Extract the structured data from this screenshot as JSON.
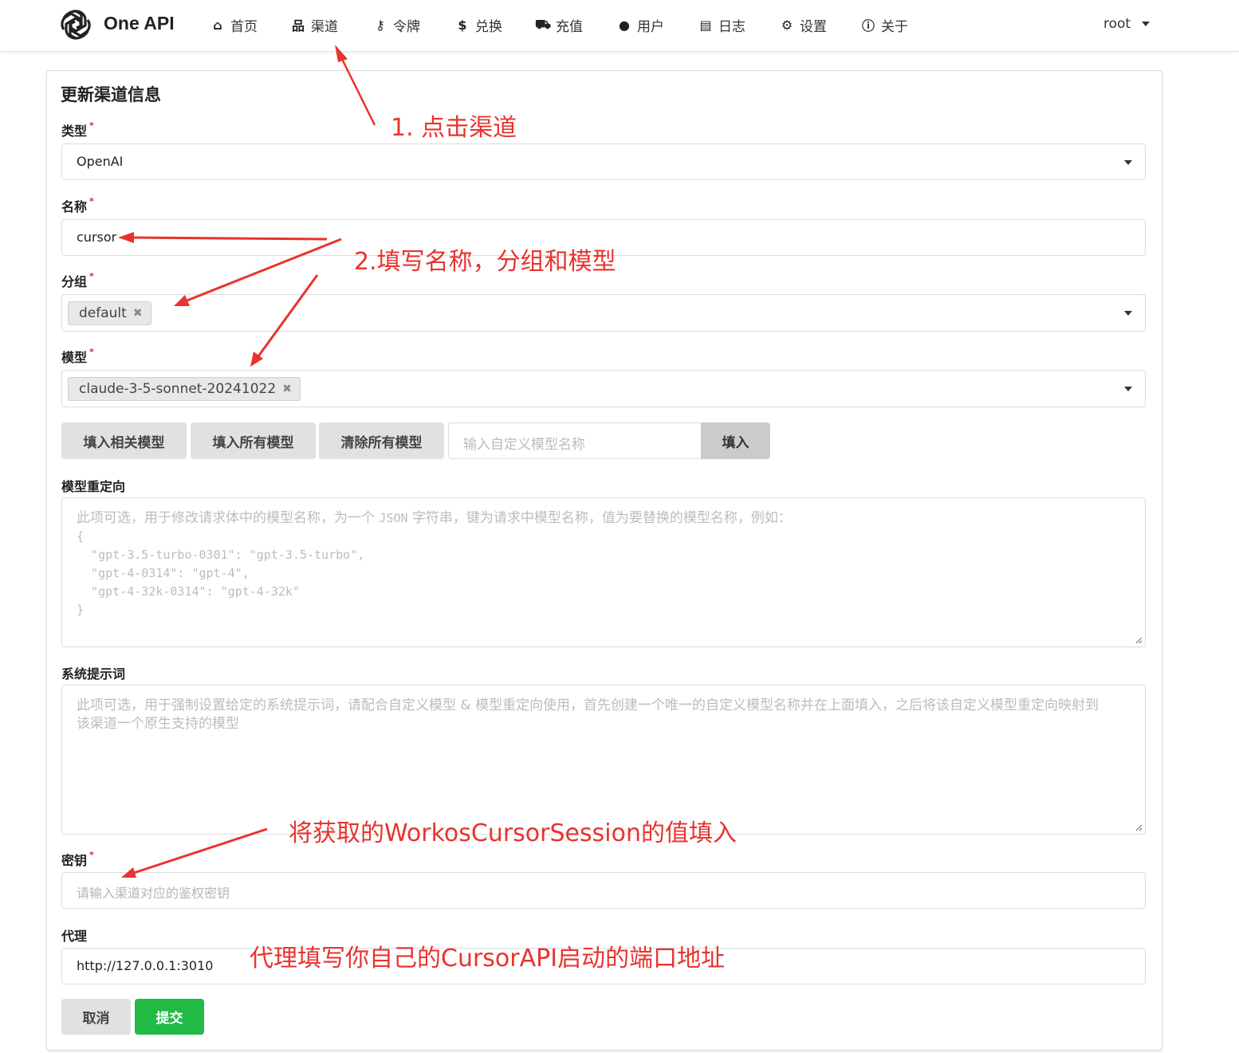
{
  "nav": {
    "brand": "One API",
    "items": [
      {
        "label": "首页",
        "icon": "home-icon",
        "glyph": "⌂"
      },
      {
        "label": "渠道",
        "icon": "sitemap-icon",
        "glyph": "品"
      },
      {
        "label": "令牌",
        "icon": "key-icon",
        "glyph": "⚷"
      },
      {
        "label": "兑换",
        "icon": "dollar-icon",
        "glyph": "$"
      },
      {
        "label": "充值",
        "icon": "cart-icon",
        "glyph": "⛟"
      },
      {
        "label": "用户",
        "icon": "user-icon",
        "glyph": "●"
      },
      {
        "label": "日志",
        "icon": "book-icon",
        "glyph": "▤"
      },
      {
        "label": "设置",
        "icon": "gear-icon",
        "glyph": "⚙"
      },
      {
        "label": "关于",
        "icon": "info-icon",
        "glyph": "ⓘ"
      }
    ],
    "user": "root"
  },
  "form": {
    "title": "更新渠道信息",
    "type_label": "类型",
    "type_value": "OpenAI",
    "name_label": "名称",
    "name_value": "cursor",
    "group_label": "分组",
    "group_tag": "default",
    "model_label": "模型",
    "model_tag": "claude-3-5-sonnet-20241022",
    "btn_fill_related": "填入相关模型",
    "btn_fill_all": "填入所有模型",
    "btn_clear_all": "清除所有模型",
    "custom_model_placeholder": "输入自定义模型名称",
    "btn_fill": "填入",
    "redirect_label": "模型重定向",
    "redirect_placeholder_line1": "此项可选，用于修改请求体中的模型名称，为一个",
    "redirect_placeholder_json": "JSON",
    "redirect_placeholder_line1b": "字符串，键为请求中模型名称，值为要替换的模型名称，例如：",
    "redirect_example": "{\n  \"gpt-3.5-turbo-0301\": \"gpt-3.5-turbo\",\n  \"gpt-4-0314\": \"gpt-4\",\n  \"gpt-4-32k-0314\": \"gpt-4-32k\"\n}",
    "system_prompt_label": "系统提示词",
    "system_prompt_placeholder": "此项可选，用于强制设置给定的系统提示词，请配合自定义模型 & 模型重定向使用，首先创建一个唯一的自定义模型名称并在上面填入，之后将该自定义模型重定向映射到\n该渠道一个原生支持的模型",
    "key_label": "密钥",
    "key_placeholder": "请输入渠道对应的鉴权密钥",
    "proxy_label": "代理",
    "proxy_value": "http://127.0.0.1:3010",
    "btn_cancel": "取消",
    "btn_submit": "提交"
  },
  "annotations": {
    "a1": "1. 点击渠道",
    "a2": "2.填写名称，分组和模型",
    "a3": "将获取的WorkosCursorSession的值填入",
    "a4": "代理填写你自己的CursorAPI启动的端口地址"
  },
  "colors": {
    "annotation": "#e8332f",
    "submit": "#21ba45",
    "required": "#db2828"
  }
}
